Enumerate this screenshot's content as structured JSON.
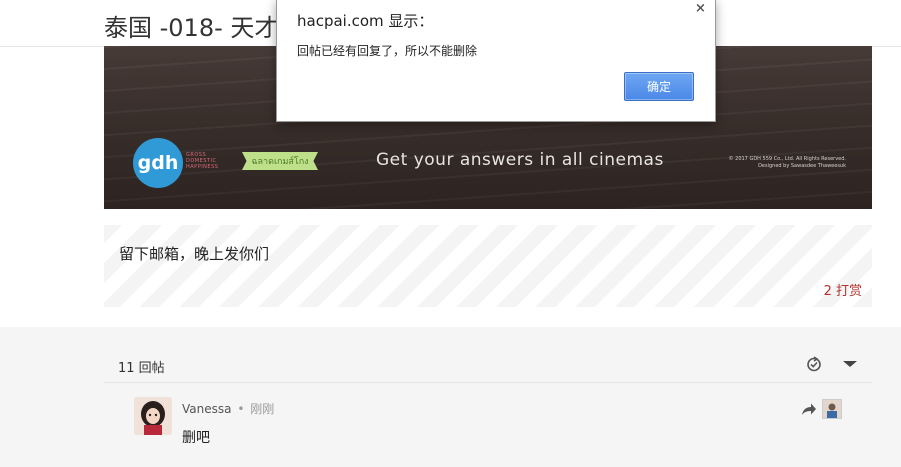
{
  "header": {
    "title": "泰国 -018- 天才枪手"
  },
  "banner": {
    "logo_text": "gdh",
    "logo_tag": "GROSS DOMESTIC HAPPINESS",
    "thai_tag": "ฉลาดเกมส์โกง",
    "tagline": "Get your answers in all cinemas",
    "copyright_line1": "© 2017 GDH 559 Co., Ltd. All Rights Reserved.",
    "copyright_line2": "Designed by Sawasdee Thaweesuk"
  },
  "post": {
    "text": "留下邮箱，晚上发你们",
    "reward": "2 打赏"
  },
  "comments": {
    "count_label": "11 回帖",
    "items": [
      {
        "user": "Vanessa",
        "separator": "•",
        "time": "刚刚",
        "text": "删吧"
      }
    ]
  },
  "dialog": {
    "title": "hacpai.com 显示：",
    "message": "回帖已经有回复了，所以不能删除",
    "ok_label": "确定",
    "close_glyph": "×"
  }
}
